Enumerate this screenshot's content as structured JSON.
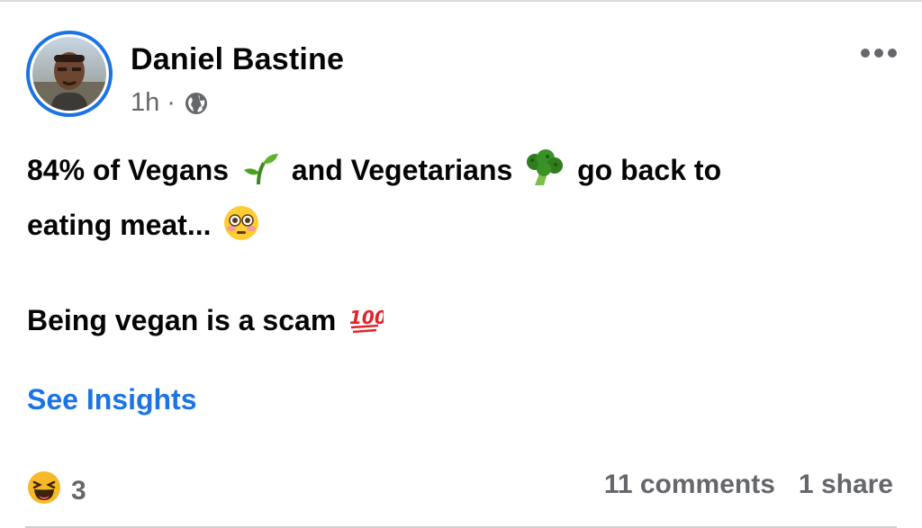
{
  "post": {
    "author": "Daniel Bastine",
    "time": "1h",
    "separator": "·",
    "audience_icon": "globe-icon",
    "more_icon": "more-options-icon",
    "text": {
      "line1_a": "84% of Vegans",
      "line1_b": "and Vegetarians",
      "line1_c": "go back to",
      "line2": "eating meat...",
      "line3": "Being vegan is a scam"
    },
    "emojis": [
      "seedling-emoji",
      "broccoli-emoji",
      "flushed-face-emoji",
      "hundred-points-emoji"
    ],
    "insights_label": "See Insights",
    "reaction_icon": "haha-reaction-icon",
    "reaction_count": "3",
    "comments": "11 comments",
    "shares": "1 share"
  },
  "colors": {
    "link": "#1b74e4",
    "secondary_text": "#65676b",
    "primary_text": "#050505",
    "avatar_ring": "#1b74e4"
  }
}
